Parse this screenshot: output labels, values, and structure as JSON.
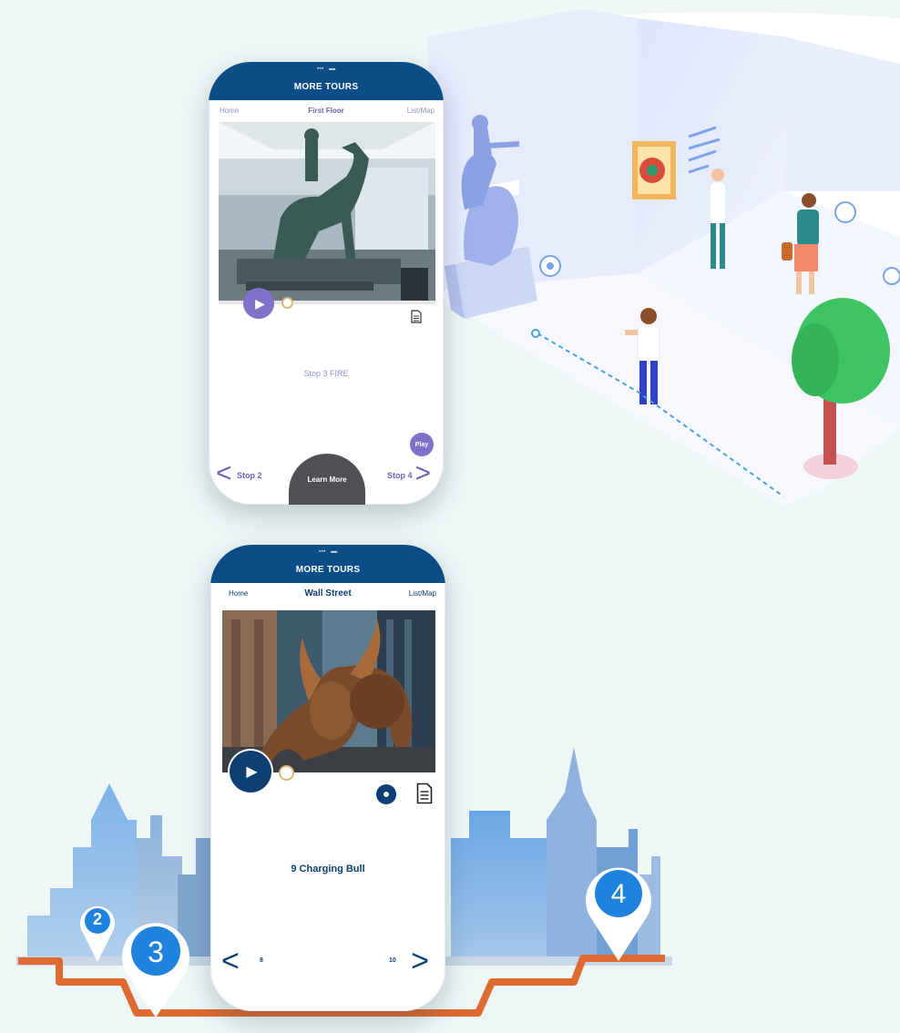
{
  "phone_top": {
    "header": "MORE TOURS",
    "nav_left": "Home",
    "nav_title": "First Floor",
    "nav_right": "List/Map",
    "stop_caption": "Stop 3 FIRE",
    "play_small_label": "Play",
    "prev_label": "Stop 2",
    "learn_more_label": "Learn More",
    "next_label": "Stop 4",
    "play_button_color": "#7f70c8",
    "accent_text_color": "#6c63b5"
  },
  "phone_bottom": {
    "header": "MORE TOURS",
    "nav_left": "Home",
    "nav_title": "Wall Street",
    "nav_right": "List/Map",
    "stop_caption": "9 Charging Bull",
    "prev_label": "8",
    "next_label": "10",
    "play_button_color": "#0d3f73",
    "accent_text_color": "#0d3f73"
  },
  "map_pins": [
    {
      "label": "2"
    },
    {
      "label": "3"
    },
    {
      "label": "4"
    }
  ],
  "colors": {
    "header_blue": "#0d4d87",
    "route_orange": "#de6a32",
    "pin_blue": "#1f82dd",
    "background": "#eef7f6"
  }
}
